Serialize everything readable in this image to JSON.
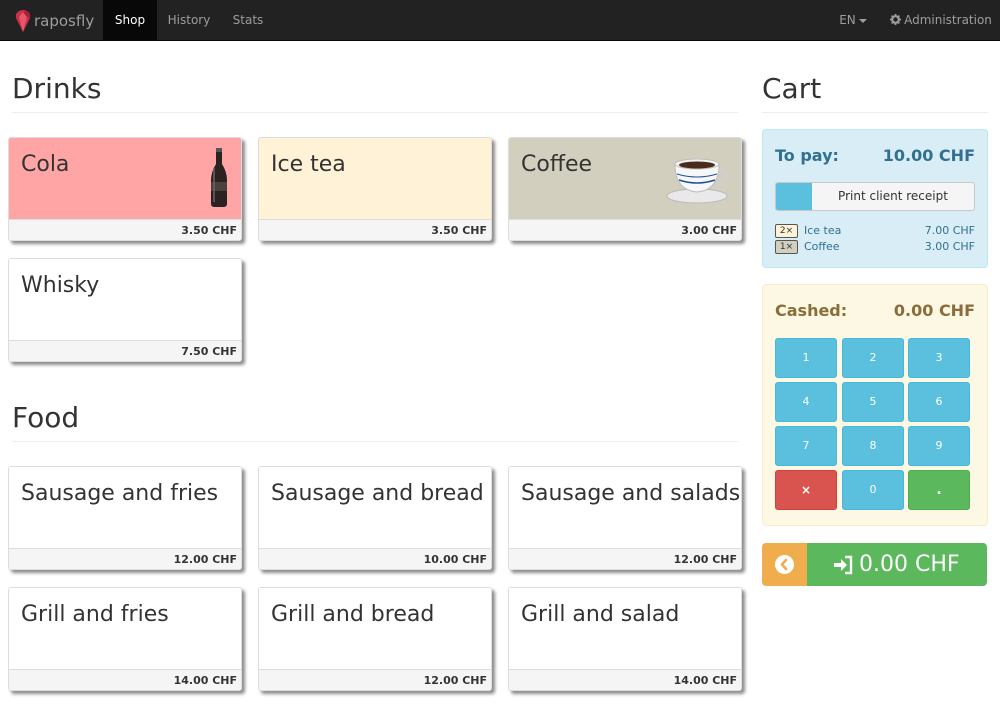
{
  "navbar": {
    "brand": "raposfly",
    "tabs": [
      {
        "label": "Shop",
        "active": true
      },
      {
        "label": "History",
        "active": false
      },
      {
        "label": "Stats",
        "active": false
      }
    ],
    "language": "EN",
    "admin": "Administration"
  },
  "sections": [
    {
      "title": "Drinks",
      "products": [
        {
          "name": "Cola",
          "price": "3.50 CHF",
          "color": "#ffa5a5",
          "image": "cola-bottle-icon"
        },
        {
          "name": "Ice tea",
          "price": "3.50 CHF",
          "color": "#fff2d6",
          "image": ""
        },
        {
          "name": "Coffee",
          "price": "3.00 CHF",
          "color": "#d3cfbe",
          "image": "coffee-cup-icon"
        },
        {
          "name": "Whisky",
          "price": "7.50 CHF",
          "color": "#ffffff",
          "image": ""
        }
      ]
    },
    {
      "title": "Food",
      "products": [
        {
          "name": "Sausage and fries",
          "price": "12.00 CHF",
          "color": "#ffffff"
        },
        {
          "name": "Sausage and bread",
          "price": "10.00 CHF",
          "color": "#ffffff"
        },
        {
          "name": "Sausage and salads",
          "price": "12.00 CHF",
          "color": "#ffffff"
        },
        {
          "name": "Grill and fries",
          "price": "14.00 CHF",
          "color": "#ffffff"
        },
        {
          "name": "Grill and bread",
          "price": "12.00 CHF",
          "color": "#ffffff"
        },
        {
          "name": "Grill and salad",
          "price": "14.00 CHF",
          "color": "#ffffff"
        }
      ]
    }
  ],
  "cart": {
    "title": "Cart",
    "to_pay_label": "To pay:",
    "to_pay_amount": "10.00 CHF",
    "receipt_label": "Print client receipt",
    "receipt_progress": 0.18,
    "items": [
      {
        "qty": "2×",
        "name": "Ice tea",
        "price": "7.00 CHF",
        "badge_color": "#fff2d6"
      },
      {
        "qty": "1×",
        "name": "Coffee",
        "price": "3.00 CHF",
        "badge_color": "#d3cfbe"
      }
    ],
    "cashed_label": "Cashed:",
    "cashed_amount": "0.00 CHF",
    "keypad": [
      "1",
      "2",
      "3",
      "4",
      "5",
      "6",
      "7",
      "8",
      "9",
      "×",
      "0",
      "."
    ],
    "pay_amount": "0.00 CHF"
  },
  "colors": {
    "info": "#5bc0de",
    "success": "#5cb85c",
    "danger": "#d9534f",
    "warning": "#f0ad4e"
  }
}
